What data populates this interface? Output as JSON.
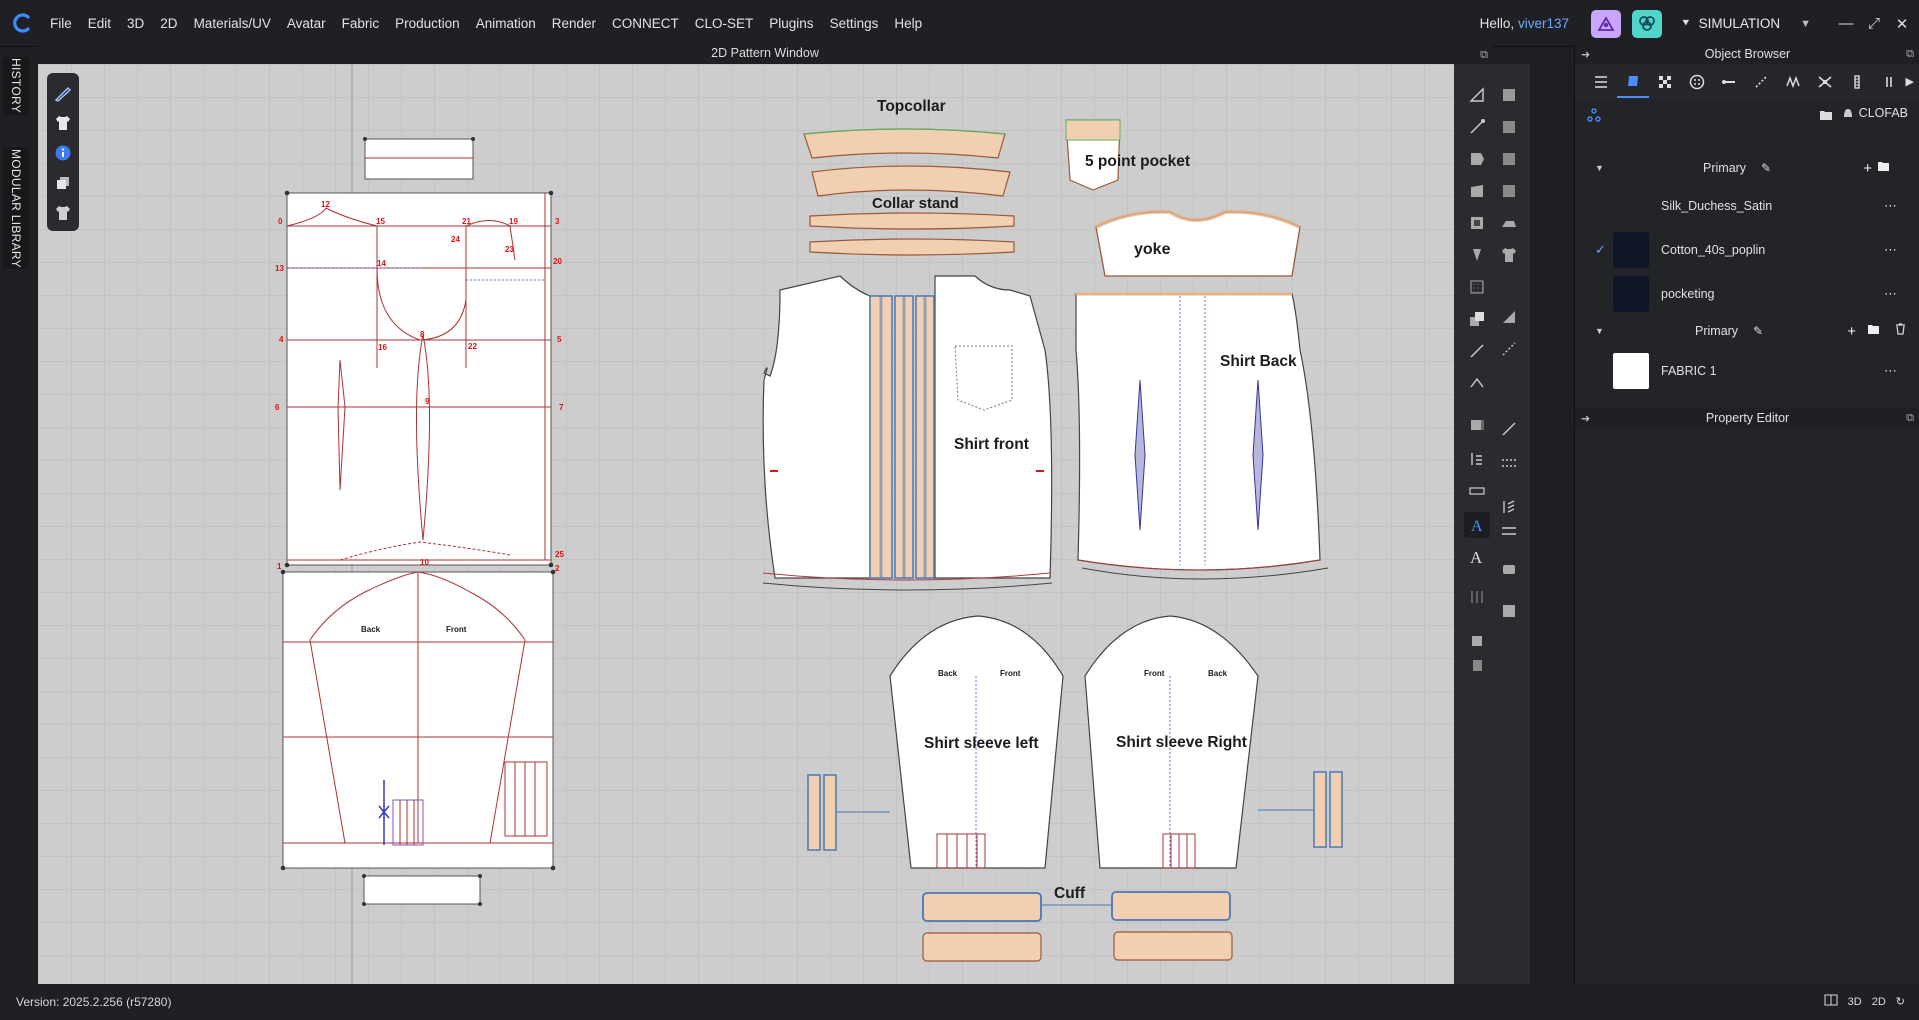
{
  "menu": [
    "File",
    "Edit",
    "3D",
    "2D",
    "Materials/UV",
    "Avatar",
    "Fabric",
    "Production",
    "Animation",
    "Render",
    "CONNECT",
    "CLO-SET",
    "Plugins",
    "Settings",
    "Help"
  ],
  "user": {
    "greeting": "Hello,",
    "name": "viver137"
  },
  "mode": {
    "label": "SIMULATION"
  },
  "left_tabs": {
    "history": "HISTORY",
    "library": "MODULAR LIBRARY"
  },
  "pattern_window": {
    "title": "2D Pattern Window"
  },
  "pattern_labels": {
    "topcollar": "Topcollar",
    "collar_stand": "Collar stand",
    "pocket": "5 point pocket",
    "yoke": "yoke",
    "shirt_front": "Shirt front",
    "shirt_back": "Shirt Back",
    "sleeve_left": "Shirt sleeve left",
    "sleeve_right": "Shirt sleeve Right",
    "cuff": "Cuff",
    "back": "Back",
    "front": "Front"
  },
  "block_numbers": [
    "12",
    "15",
    "21",
    "19",
    "0",
    "3",
    "13",
    "14",
    "24",
    "23",
    "20",
    "4",
    "8",
    "5",
    "16",
    "22",
    "6",
    "9",
    "7",
    "1",
    "10",
    "25",
    "2"
  ],
  "object_browser": {
    "title": "Object Browser",
    "library": "CLOFAB",
    "groups": [
      {
        "name": "Primary",
        "fabrics": [
          {
            "name": "Silk_Duchess_Satin",
            "checked": false,
            "swatch": "#222326"
          },
          {
            "name": "Cotton_40s_poplin",
            "checked": true,
            "swatch": "#0f1628"
          },
          {
            "name": "pocketing",
            "checked": false,
            "swatch": "#0f1628"
          }
        ]
      },
      {
        "name": "Primary",
        "fabrics": [
          {
            "name": "FABRIC 1",
            "checked": false,
            "swatch": "#ffffff"
          }
        ]
      }
    ]
  },
  "property_editor": {
    "title": "Property Editor"
  },
  "status": {
    "version": "Version: 2025.2.256 (r57280)"
  },
  "colors": {
    "accent": "#4b8cff",
    "username": "#6fa8ff",
    "canvas": "#cdcdcd",
    "pattern_fill": "#f7f7f7",
    "collar_fill": "#f1cfb1",
    "seam_red": "#b33a3a"
  }
}
